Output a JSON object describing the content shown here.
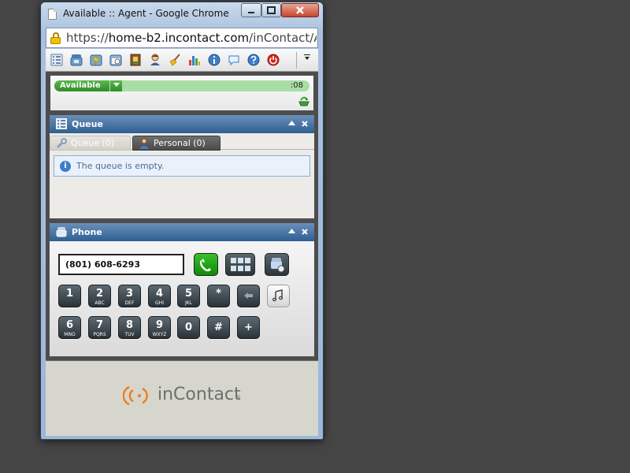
{
  "window": {
    "title": "Available :: Agent - Google Chrome",
    "minimize_icon": "minimize-icon",
    "maximize_icon": "maximize-icon",
    "close_icon": "close-icon"
  },
  "address_bar": {
    "scheme": "https://",
    "host": "home-b2.incontact.com",
    "path": "/inContact/Ag"
  },
  "toolbar": {
    "icons": [
      "list-icon",
      "phone-icon",
      "lightning-icon",
      "calendar-icon",
      "address-book-icon",
      "agent-icon",
      "broom-icon",
      "chart-icon",
      "info-icon",
      "chat-icon",
      "help-icon",
      "power-icon"
    ],
    "more_icon": "chevron-down-icon"
  },
  "status": {
    "state": "Available",
    "timer": ":08",
    "colors": {
      "pill": "#3a9a30",
      "bar": "#a8dea4"
    }
  },
  "queue_panel": {
    "title": "Queue",
    "tabs": [
      {
        "label": "Queue (0)",
        "icon": "wrench-icon"
      },
      {
        "label": "Personal (0)",
        "icon": "person-icon"
      }
    ],
    "message": "The queue is empty."
  },
  "phone_panel": {
    "title": "Phone",
    "dial_value": "(801) 608-6293",
    "keys_row1": [
      {
        "digit": "1",
        "letters": ""
      },
      {
        "digit": "2",
        "letters": "ABC"
      },
      {
        "digit": "3",
        "letters": "DEF"
      },
      {
        "digit": "4",
        "letters": "GHI"
      },
      {
        "digit": "5",
        "letters": "JKL"
      },
      {
        "digit": "*",
        "letters": ""
      }
    ],
    "keys_row2": [
      {
        "digit": "6",
        "letters": "MNO"
      },
      {
        "digit": "7",
        "letters": "PQRS"
      },
      {
        "digit": "8",
        "letters": "TUV"
      },
      {
        "digit": "9",
        "letters": "WXYZ"
      },
      {
        "digit": "0",
        "letters": ""
      },
      {
        "digit": "#",
        "letters": ""
      },
      {
        "digit": "+",
        "letters": ""
      }
    ],
    "call_color": "#1fa416"
  },
  "footer": {
    "logo_text": "inContact",
    "logo_mark": "®",
    "brand_color": "#f07b1e"
  }
}
